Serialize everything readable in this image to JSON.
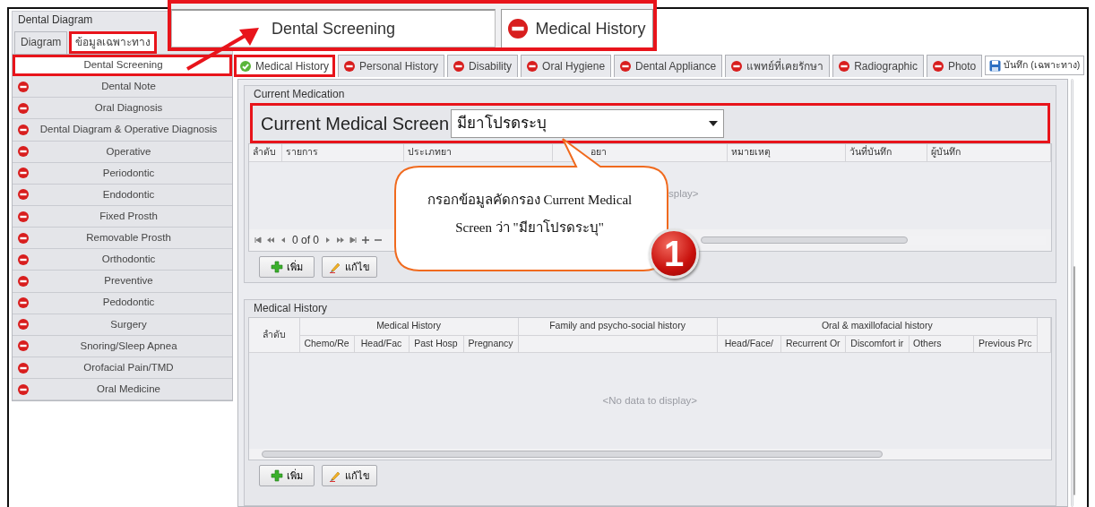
{
  "window": {
    "title": "Dental Diagram"
  },
  "zoom_callout": {
    "item_label": "Dental Screening",
    "tab": {
      "label": "Medical History",
      "kind": "missing"
    }
  },
  "sidebar": {
    "tabs": [
      {
        "label": "Diagram",
        "selected": false,
        "annotated": false
      },
      {
        "label": "ข้อมูลเฉพาะทาง",
        "selected": true,
        "annotated": true
      }
    ],
    "items": [
      {
        "label": "Dental Screening",
        "kind": "plain",
        "selected": true,
        "annotated": true
      },
      {
        "label": "Dental Note",
        "kind": "missing",
        "selected": false,
        "annotated": false
      },
      {
        "label": "Oral Diagnosis",
        "kind": "missing",
        "selected": false,
        "annotated": false
      },
      {
        "label": "Dental Diagram & Operative Diagnosis",
        "kind": "missing",
        "selected": false,
        "annotated": false
      },
      {
        "label": "Operative",
        "kind": "missing",
        "selected": false,
        "annotated": false
      },
      {
        "label": "Periodontic",
        "kind": "missing",
        "selected": false,
        "annotated": false
      },
      {
        "label": "Endodontic",
        "kind": "missing",
        "selected": false,
        "annotated": false
      },
      {
        "label": "Fixed Prosth",
        "kind": "missing",
        "selected": false,
        "annotated": false
      },
      {
        "label": "Removable Prosth",
        "kind": "missing",
        "selected": false,
        "annotated": false
      },
      {
        "label": "Orthodontic",
        "kind": "missing",
        "selected": false,
        "annotated": false
      },
      {
        "label": "Preventive",
        "kind": "missing",
        "selected": false,
        "annotated": false
      },
      {
        "label": "Pedodontic",
        "kind": "missing",
        "selected": false,
        "annotated": false
      },
      {
        "label": "Surgery",
        "kind": "missing",
        "selected": false,
        "annotated": false
      },
      {
        "label": "Snoring/Sleep Apnea",
        "kind": "missing",
        "selected": false,
        "annotated": false
      },
      {
        "label": "Orofacial Pain/TMD",
        "kind": "missing",
        "selected": false,
        "annotated": false
      },
      {
        "label": "Oral Medicine",
        "kind": "missing",
        "selected": false,
        "annotated": false
      }
    ]
  },
  "tabs": [
    {
      "label": "Medical History",
      "kind": "done",
      "selected": true,
      "annotated": true
    },
    {
      "label": "Personal History",
      "kind": "missing",
      "selected": false,
      "annotated": false
    },
    {
      "label": "Disability",
      "kind": "missing",
      "selected": false,
      "annotated": false
    },
    {
      "label": "Oral Hygiene",
      "kind": "missing",
      "selected": false,
      "annotated": false
    },
    {
      "label": "Dental Appliance",
      "kind": "missing",
      "selected": false,
      "annotated": false
    },
    {
      "label": "แพทย์ที่เคยรักษา",
      "kind": "missing",
      "selected": false,
      "annotated": false
    },
    {
      "label": "Radiographic",
      "kind": "missing",
      "selected": false,
      "annotated": false
    },
    {
      "label": "Photo",
      "kind": "missing",
      "selected": false,
      "annotated": false
    }
  ],
  "save_button": {
    "label": "บันทึก (เฉพาะทาง)"
  },
  "current_medication": {
    "title": "Current Medication",
    "screen_label": "Current Medical Screen",
    "screen_value": "มียาโปรดระบุ",
    "annotated": true,
    "columns": [
      "ลำดับ",
      "รายการ",
      "ประเภทยา",
      "อยา",
      "หมายเหตุ",
      "วันที่บันทึก",
      "ผู้บันทึก"
    ],
    "empty_text": "splay>",
    "pager_text": "0 of 0",
    "buttons": [
      {
        "label": "เพิ่ม",
        "kind": "add"
      },
      {
        "label": "แก้ไข",
        "kind": "edit"
      }
    ]
  },
  "callout_note": {
    "text": "กรอกข้อมูลคัดกรอง Current Medical Screen ว่า \"มียาโปรดระบุ\"",
    "step": "1"
  },
  "medical_history": {
    "title": "Medical History",
    "index_column": "ลำดับ",
    "groups": [
      {
        "label": "Medical History",
        "columns": [
          "Chemo/Re",
          "Head/Fac",
          "Past Hosp",
          "Pregnancy"
        ]
      },
      {
        "label": "Family and psycho-social history"
      },
      {
        "label": "Oral & maxillofacial history",
        "columns": [
          "Head/Face/",
          "Recurrent Or",
          "Discomfort ir",
          "Others",
          "Previous Prc"
        ]
      }
    ],
    "empty_text": "<No data to display>",
    "buttons": [
      {
        "label": "เพิ่ม",
        "kind": "add"
      },
      {
        "label": "แก้ไข",
        "kind": "edit"
      }
    ]
  }
}
